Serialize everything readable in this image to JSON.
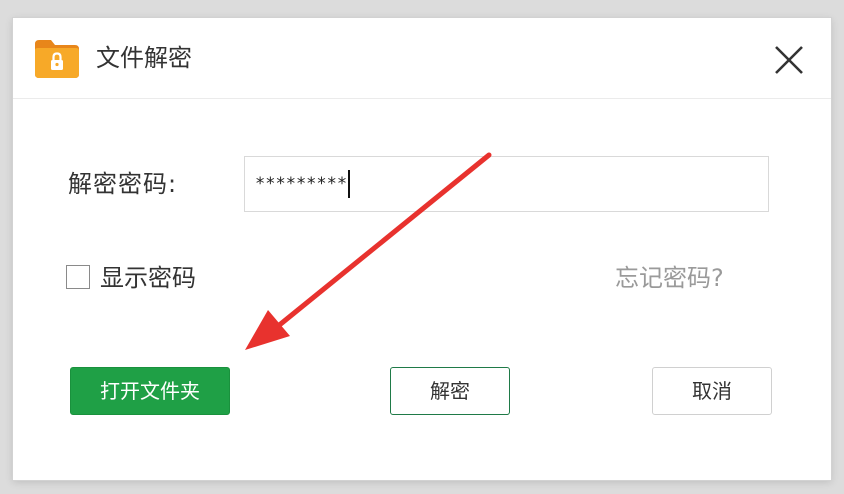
{
  "dialog": {
    "title": "文件解密",
    "icon": "folder-lock-icon",
    "close_icon": "close-icon"
  },
  "form": {
    "password_label": "解密密码:",
    "password_value": "*********",
    "show_password_label": "显示密码",
    "show_password_checked": false,
    "forgot_password_link": "忘记密码?"
  },
  "buttons": {
    "open_folder": "打开文件夹",
    "decrypt": "解密",
    "cancel": "取消"
  },
  "annotation": {
    "arrow_color": "#e8322e",
    "arrow_icon": "red-arrow-annotation"
  },
  "colors": {
    "primary_green": "#1fa046",
    "folder_orange": "#f5a623"
  }
}
